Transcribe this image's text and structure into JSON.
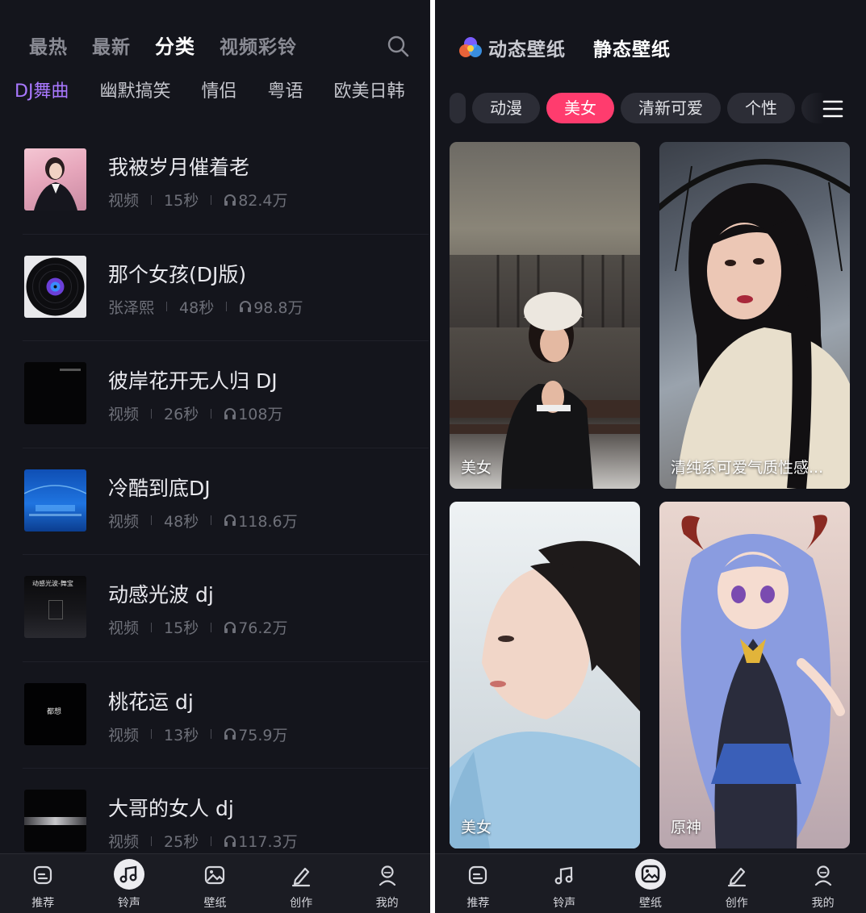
{
  "left": {
    "top_tabs": [
      "最热",
      "最新",
      "分类",
      "视频彩铃"
    ],
    "active_top_tab": "分类",
    "sub_tabs": [
      "DJ舞曲",
      "幽默搞笑",
      "情侣",
      "粤语",
      "欧美日韩"
    ],
    "active_sub_tab": "DJ舞曲",
    "songs": [
      {
        "title": "我被岁月催着老",
        "source": "视频",
        "duration": "15秒",
        "plays": "82.4万"
      },
      {
        "title": "那个女孩(DJ版)",
        "source": "张泽熙",
        "duration": "48秒",
        "plays": "98.8万"
      },
      {
        "title": "彼岸花开无人归 DJ",
        "source": "视频",
        "duration": "26秒",
        "plays": "108万"
      },
      {
        "title": "冷酷到底DJ",
        "source": "视频",
        "duration": "48秒",
        "plays": "118.6万"
      },
      {
        "title": "动感光波 dj",
        "source": "视频",
        "duration": "15秒",
        "plays": "76.2万"
      },
      {
        "title": "桃花运 dj",
        "source": "视频",
        "duration": "13秒",
        "plays": "75.9万"
      },
      {
        "title": "大哥的女人 dj",
        "source": "视频",
        "duration": "25秒",
        "plays": "117.3万"
      }
    ],
    "thumb_texts": [
      "动感光波-舞宝",
      "都想"
    ],
    "bottom_nav": [
      "推荐",
      "铃声",
      "壁纸",
      "创作",
      "我的"
    ],
    "active_nav": "铃声"
  },
  "right": {
    "tab_dynamic": "动态壁纸",
    "tab_static": "静态壁纸",
    "active_tab": "静态壁纸",
    "chips": [
      "动漫",
      "美女",
      "清新可爱",
      "个性"
    ],
    "active_chip": "美女",
    "cards": [
      {
        "label": "美女"
      },
      {
        "label": "清纯系可爱气质性感..."
      },
      {
        "label": "美女"
      },
      {
        "label": "原神"
      }
    ],
    "bottom_nav": [
      "推荐",
      "铃声",
      "壁纸",
      "创作",
      "我的"
    ],
    "active_nav": "壁纸"
  },
  "colors": {
    "background": "#14151c",
    "accent_purple": "#a978ff",
    "accent_pink": "#ff3c6e",
    "nav_bg": "#1b1c23"
  },
  "icons": {
    "search": "search-icon",
    "headphones": "headphones-icon",
    "menu": "menu-icon",
    "nav": [
      "home-icon",
      "music-note-icon",
      "image-icon",
      "pen-icon",
      "user-icon"
    ]
  }
}
